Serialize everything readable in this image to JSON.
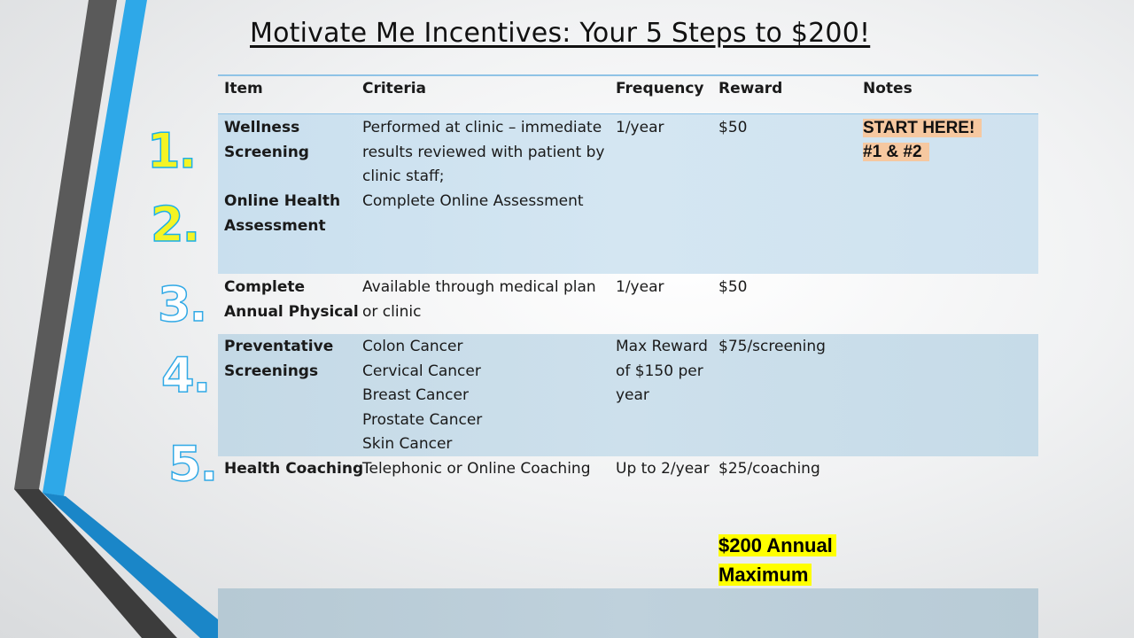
{
  "title": "Motivate Me Incentives: Your 5 Steps to $200!",
  "headers": {
    "item": "Item",
    "criteria": "Criteria",
    "frequency": "Frequency",
    "reward": "Reward",
    "notes": "Notes"
  },
  "step_numbers": [
    "1.",
    "2.",
    "3.",
    "4.",
    "5."
  ],
  "rows": {
    "wellness": {
      "item": "Wellness\nScreening",
      "criteria": "Performed at clinic – immediate\nresults reviewed with patient by\nclinic staff;",
      "frequency": "1/year",
      "reward": "$50",
      "notes_line1": "START HERE!",
      "notes_line2": "#1 & #2"
    },
    "online": {
      "item": "Online Health\nAssessment",
      "criteria": "Complete Online Assessment"
    },
    "physical": {
      "item": "Complete\nAnnual Physical",
      "criteria": "Available through medical plan\nor clinic",
      "frequency": "1/year",
      "reward": "$50"
    },
    "screenings": {
      "item": "Preventative\nScreenings",
      "criteria": "Colon Cancer\nCervical Cancer\nBreast Cancer\nProstate Cancer\nSkin Cancer",
      "frequency": "Max Reward\nof $150 per\nyear",
      "reward": "$75/screening"
    },
    "coaching": {
      "item": "Health Coaching",
      "criteria": "Telephonic or Online Coaching",
      "frequency": "Up to 2/year",
      "reward": "$25/coaching"
    }
  },
  "annual_max_line1": "$200 Annual",
  "annual_max_line2": "Maximum",
  "colors": {
    "accent_blue": "#2ea8e8",
    "dark_gray": "#555555",
    "highlight_yellow": "#ffff00",
    "note_peach": "#f6c8a0",
    "step_yellow": "#f4f425"
  }
}
